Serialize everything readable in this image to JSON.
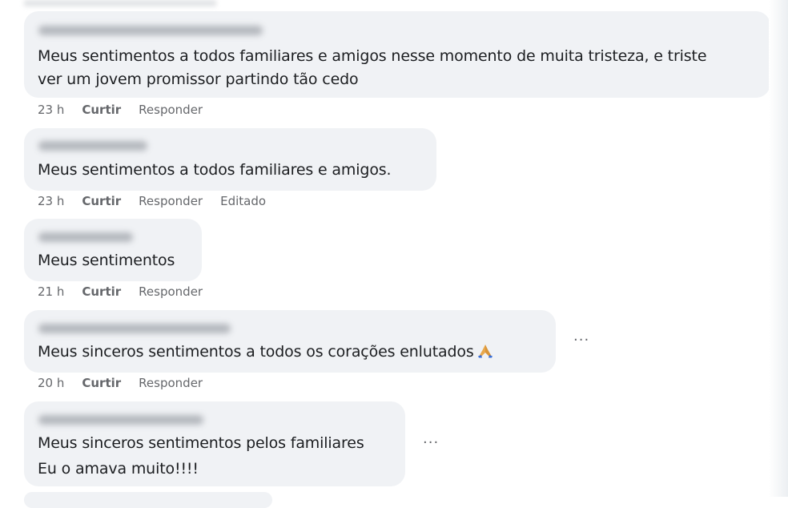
{
  "comments": [
    {
      "text_lines": [
        "Meus sentimentos a todos familiares e amigos nesse momento de muita tristeza, e triste",
        "ver um jovem promissor partindo tão cedo"
      ],
      "time": "23 h",
      "like": "Curtir",
      "reply": "Responder"
    },
    {
      "text_lines": [
        "Meus sentimentos a todos familiares e amigos."
      ],
      "time": "23 h",
      "like": "Curtir",
      "reply": "Responder",
      "edited": "Editado"
    },
    {
      "text_lines": [
        "Meus sentimentos"
      ],
      "time": "21 h",
      "like": "Curtir",
      "reply": "Responder"
    },
    {
      "text_lines": [
        "Meus sinceros sentimentos a todos os corações enlutados"
      ],
      "emoji": "folded-hands",
      "time": "20 h",
      "like": "Curtir",
      "reply": "Responder",
      "more": "···"
    },
    {
      "text_lines": [
        "Meus sinceros sentimentos pelos familiares",
        "Eu o amava muito!!!!"
      ],
      "more": "···"
    }
  ],
  "colors": {
    "bubble": "#f0f2f5",
    "text": "#1c1e21",
    "meta": "#65676b"
  }
}
